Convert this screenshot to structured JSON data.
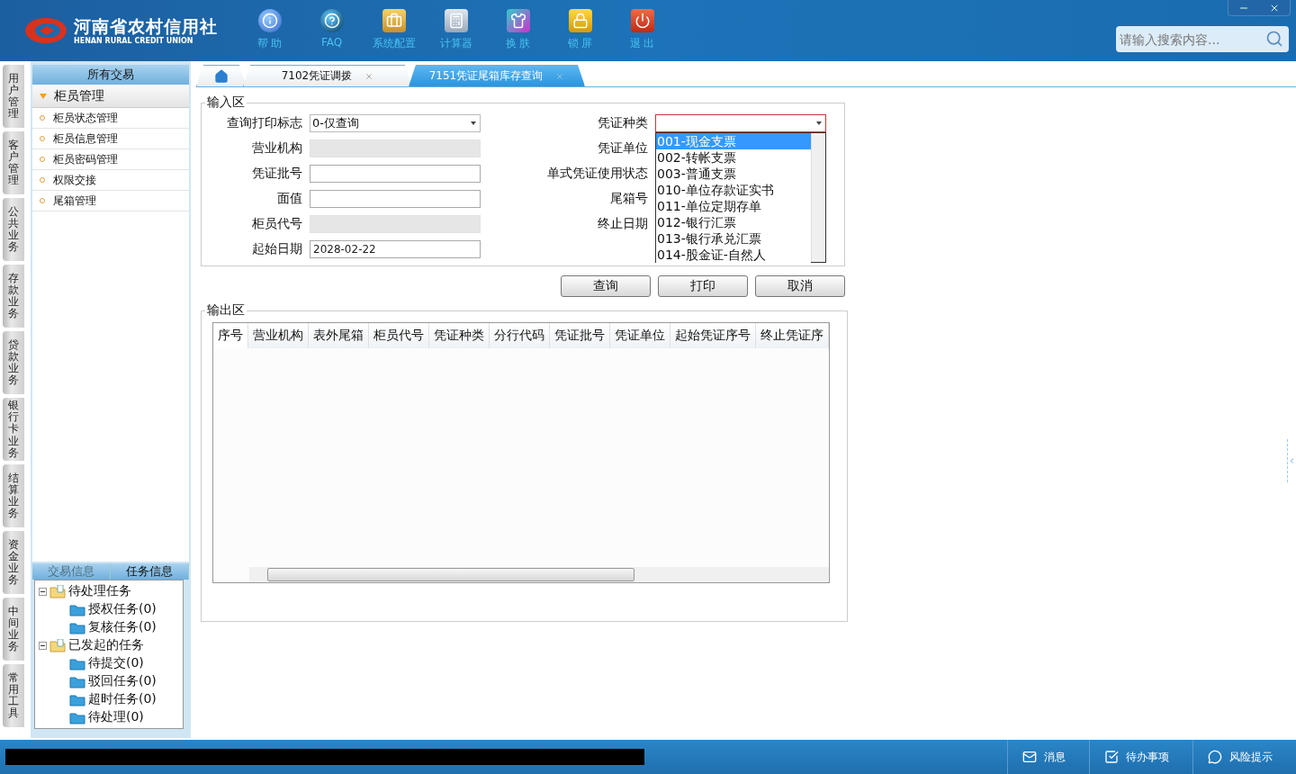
{
  "header": {
    "logo_title": "河南省农村信用社",
    "logo_subtitle": "HENAN RURAL CREDIT UNION",
    "toolbar": [
      {
        "label": "帮 助",
        "kind": "help"
      },
      {
        "label": "FAQ",
        "kind": "faq"
      },
      {
        "label": "系统配置",
        "kind": "config"
      },
      {
        "label": "计算器",
        "kind": "calculator"
      },
      {
        "label": "换 肤",
        "kind": "skin"
      },
      {
        "label": "锁 屏",
        "kind": "lock"
      },
      {
        "label": "退 出",
        "kind": "exit"
      }
    ],
    "search": {
      "placeholder": "请输入搜索内容..."
    }
  },
  "side_tabs": [
    "用户管理",
    "客户管理",
    "公共业务",
    "存款业务",
    "贷款业务",
    "银行卡业务",
    "结算业务",
    "资金业务",
    "中间业务",
    "常用工具"
  ],
  "sidebar": {
    "title": "所有交易",
    "group": {
      "label": "柜员管理",
      "expanded": true,
      "items": [
        "柜员状态管理",
        "柜员信息管理",
        "柜员密码管理",
        "权限交接",
        "尾箱管理"
      ]
    },
    "bottom_tabs": [
      {
        "label": "交易信息",
        "selected": false
      },
      {
        "label": "任务信息",
        "selected": true
      }
    ],
    "tree": [
      {
        "label": "待处理任务",
        "expanded": true,
        "children": [
          {
            "label": "授权任务(0)"
          },
          {
            "label": "复核任务(0)"
          }
        ]
      },
      {
        "label": "已发起的任务",
        "expanded": true,
        "children": [
          {
            "label": "待提交(0)"
          },
          {
            "label": "驳回任务(0)"
          },
          {
            "label": "超时任务(0)"
          },
          {
            "label": "待处理(0)"
          }
        ]
      }
    ]
  },
  "tabs": [
    {
      "kind": "home",
      "selected": false
    },
    {
      "kind": "page",
      "label": "7102凭证调拨",
      "selected": false
    },
    {
      "kind": "page",
      "label": "7151凭证尾箱库存查询",
      "selected": true
    }
  ],
  "input_section": {
    "title": "输入区",
    "left_fields": [
      {
        "label": "查询打印标志",
        "kind": "select",
        "value": "0-仅查询"
      },
      {
        "label": "营业机构",
        "kind": "text",
        "disabled": true
      },
      {
        "label": "凭证批号",
        "kind": "text",
        "disabled": false
      },
      {
        "label": "面值",
        "kind": "text",
        "disabled": false
      },
      {
        "label": "柜员代号",
        "kind": "text",
        "disabled": true
      },
      {
        "label": "起始日期",
        "kind": "text",
        "disabled": false,
        "value": "2028-02-22"
      }
    ],
    "right_fields": [
      {
        "label": "凭证种类",
        "kind": "select",
        "open": true
      },
      {
        "label": "凭证单位",
        "kind": "hidden"
      },
      {
        "label": "单式凭证使用状态",
        "kind": "hidden"
      },
      {
        "label": "尾箱号",
        "kind": "hidden"
      },
      {
        "label": "终止日期",
        "kind": "hidden"
      }
    ],
    "dropdown_options": [
      {
        "label": "001-现金支票",
        "selected": true
      },
      {
        "label": "002-转帐支票",
        "selected": false
      },
      {
        "label": "003-普通支票",
        "selected": false
      },
      {
        "label": "010-单位存款证实书",
        "selected": false
      },
      {
        "label": "011-单位定期存单",
        "selected": false
      },
      {
        "label": "012-银行汇票",
        "selected": false
      },
      {
        "label": "013-银行承兑汇票",
        "selected": false
      },
      {
        "label": "014-股金证-自然人",
        "selected": false
      }
    ]
  },
  "buttons": [
    "查询",
    "打印",
    "取消"
  ],
  "output_section": {
    "title": "输出区",
    "table": {
      "columns": [
        "序号",
        "营业机构",
        "表外尾箱",
        "柜员代号",
        "凭证种类",
        "分行代码",
        "凭证批号",
        "凭证单位",
        "起始凭证序号",
        "终止凭证序"
      ]
    }
  },
  "status_bar": {
    "items": [
      {
        "label": "消息",
        "kind": "message"
      },
      {
        "label": "待办事项",
        "kind": "todo"
      },
      {
        "label": "风险提示",
        "kind": "risk"
      }
    ]
  }
}
